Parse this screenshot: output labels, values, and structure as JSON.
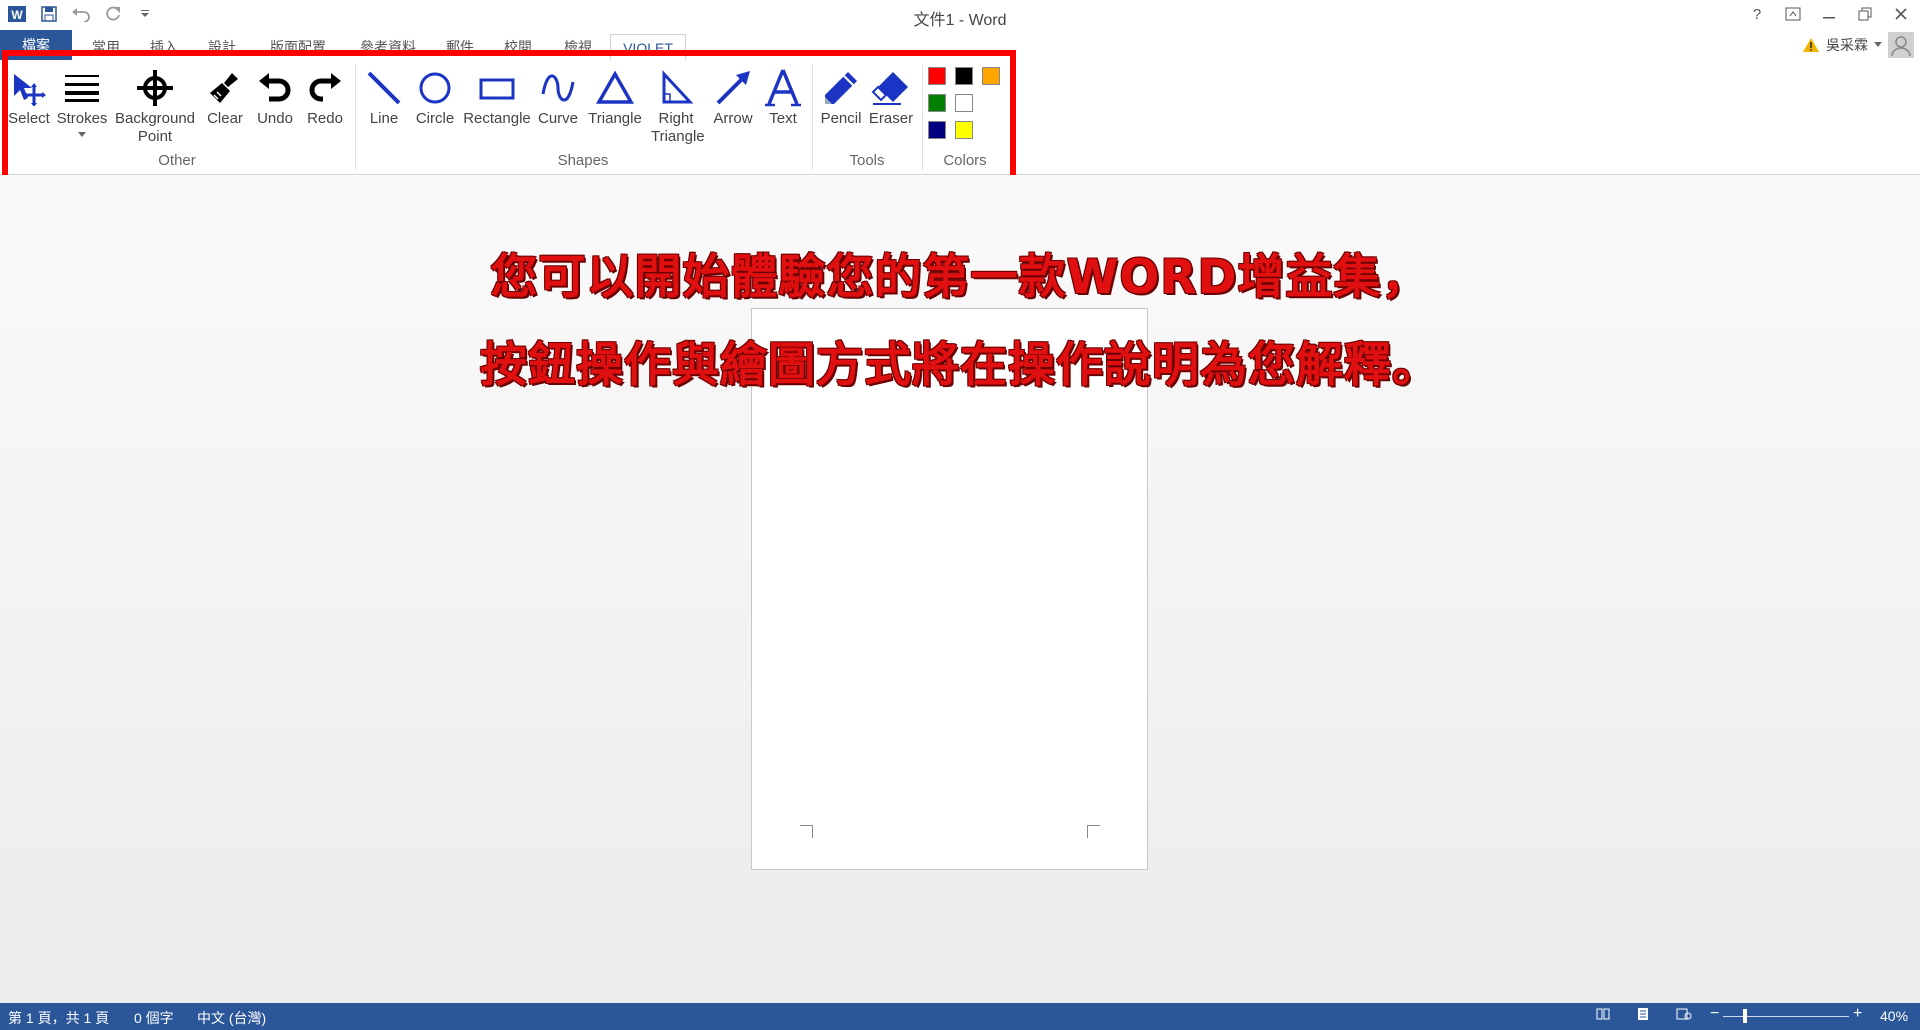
{
  "window": {
    "title": "文件1 - Word"
  },
  "tabs": [
    {
      "label": "檔案"
    },
    {
      "label": "常用"
    },
    {
      "label": "插入"
    },
    {
      "label": "設計"
    },
    {
      "label": "版面配置"
    },
    {
      "label": "參考資料"
    },
    {
      "label": "郵件"
    },
    {
      "label": "校閱"
    },
    {
      "label": "檢視"
    },
    {
      "label": "VIOLET"
    }
  ],
  "user": {
    "name": "吳采霖"
  },
  "ribbon": {
    "other": {
      "label": "Other",
      "buttons": [
        {
          "label": "Select"
        },
        {
          "label": "Strokes"
        },
        {
          "label": "Background Point"
        },
        {
          "label": "Clear"
        },
        {
          "label": "Undo"
        },
        {
          "label": "Redo"
        }
      ]
    },
    "shapes": {
      "label": "Shapes",
      "buttons": [
        {
          "label": "Line"
        },
        {
          "label": "Circle"
        },
        {
          "label": "Rectangle"
        },
        {
          "label": "Curve"
        },
        {
          "label": "Triangle"
        },
        {
          "label": "Right Triangle"
        },
        {
          "label": "Arrow"
        },
        {
          "label": "Text"
        }
      ]
    },
    "tools": {
      "label": "Tools",
      "buttons": [
        {
          "label": "Pencil"
        },
        {
          "label": "Eraser"
        }
      ]
    },
    "colors": {
      "label": "Colors",
      "swatches": [
        "#ff0000",
        "#000000",
        "#ffa500",
        "#008000",
        "#ffffff",
        "#000080",
        "#ffff00"
      ]
    }
  },
  "overlay": {
    "line1": "您可以開始體驗您的第一款WORD增益集，",
    "line2": "按鈕操作與繪圖方式將在操作說明為您解釋。"
  },
  "status": {
    "page": "第 1 頁，共 1 頁",
    "words": "0 個字",
    "language": "中文 (台灣)",
    "zoom": "40%"
  },
  "accent": "#2b579a"
}
